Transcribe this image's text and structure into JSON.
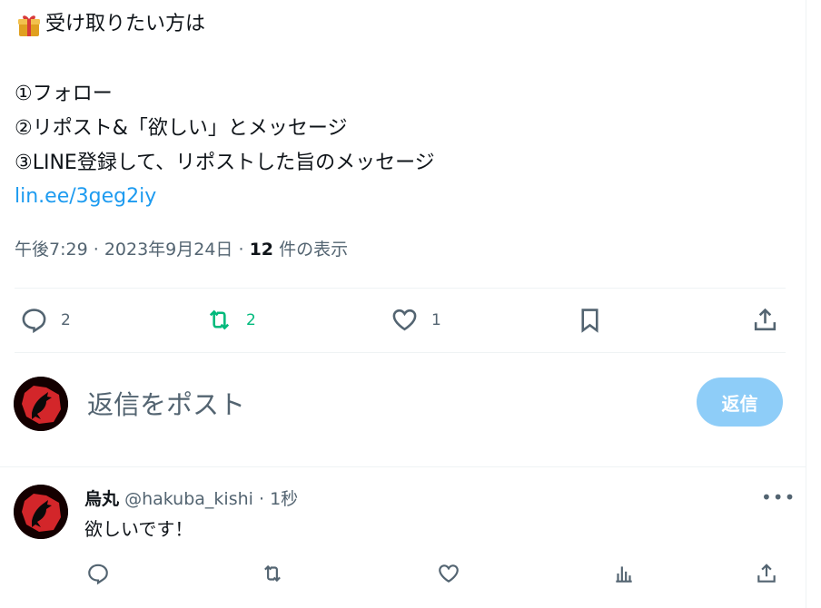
{
  "tweet": {
    "line1": "受け取りたい方は",
    "line2": "①フォロー",
    "line3": "②リポスト&「欲しい」とメッセージ",
    "line4": "③LINE登録して、リポストした旨のメッセージ",
    "link": "lin.ee/3geg2iy",
    "gift_icon": "gift-emoji",
    "time": "午後7:29",
    "date": "2023年9月24日",
    "views_count": "12",
    "views_label": "件の表示"
  },
  "actions": {
    "reply_count": "2",
    "retweet_count": "2",
    "like_count": "1"
  },
  "composer": {
    "placeholder": "返信をポスト",
    "button_label": "返信"
  },
  "reply": {
    "name": "烏丸",
    "handle": "@hakuba_kishi",
    "time": "1秒",
    "text": "欲しいです！",
    "more_label": "•••"
  },
  "colors": {
    "link": "#1d9bf0",
    "retweet_active": "#00ba7c",
    "reply_button": "#8ecdf8",
    "muted": "#536471"
  }
}
